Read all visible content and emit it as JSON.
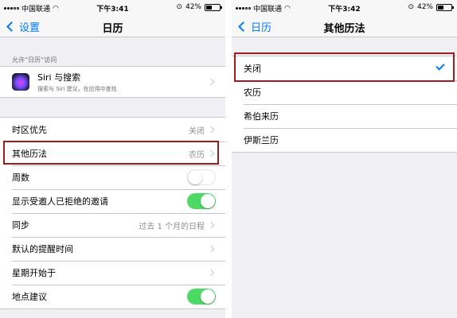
{
  "left": {
    "status": {
      "carrier": "中国联通",
      "time": "下午3:41",
      "battery": "42%",
      "battery_level": 0.42
    },
    "nav": {
      "back_label": "设置",
      "title": "日历"
    },
    "access_header": "允许“日历”访问",
    "siri": {
      "title": "Siri 与搜索",
      "subtitle": "搜索与 Siri 建议，在应用中查找"
    },
    "rows": [
      {
        "label": "时区优先",
        "value": "关闭"
      },
      {
        "label": "其他历法",
        "value": "农历"
      },
      {
        "label": "周数",
        "toggle": false
      },
      {
        "label": "显示受邀人已拒绝的邀请",
        "toggle": true
      },
      {
        "label": "同步",
        "value": "过去 1 个月的日程"
      },
      {
        "label": "默认的提醒时间",
        "value": ""
      },
      {
        "label": "星期开始于",
        "value": ""
      },
      {
        "label": "地点建议",
        "toggle": true
      }
    ]
  },
  "right": {
    "status": {
      "carrier": "中国联通",
      "time": "下午3:42",
      "battery": "42%",
      "battery_level": 0.42
    },
    "nav": {
      "back_label": "日历",
      "title": "其他历法"
    },
    "options": [
      {
        "label": "关闭",
        "selected": true
      },
      {
        "label": "农历",
        "selected": false
      },
      {
        "label": "希伯来历",
        "selected": false
      },
      {
        "label": "伊斯兰历",
        "selected": false
      }
    ]
  },
  "colors": {
    "accent": "#007aff",
    "toggle_on": "#4cd964",
    "highlight": "#a01c1c",
    "background": "#efeff4"
  }
}
